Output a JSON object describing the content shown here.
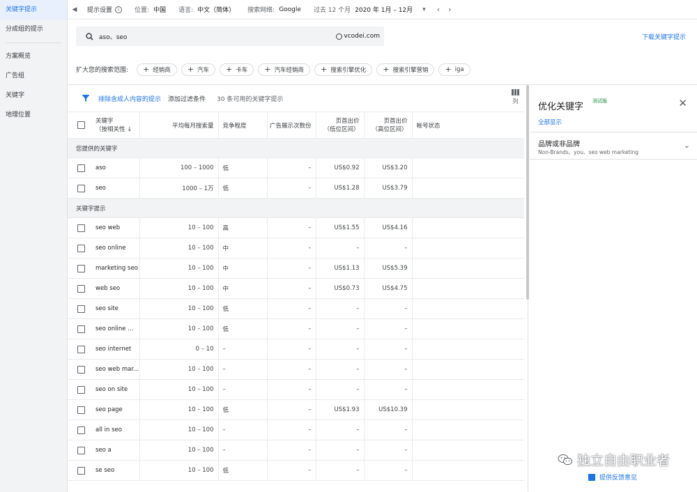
{
  "sidebar": {
    "items": [
      {
        "label": "关键字提示",
        "active": true
      },
      {
        "label": "分成组的提示"
      },
      {
        "label": "方案概览"
      },
      {
        "label": "广告组"
      },
      {
        "label": "关键字"
      },
      {
        "label": "地理位置"
      }
    ]
  },
  "topbar": {
    "title": "提示设置",
    "location_label": "位置:",
    "location_value": "中国",
    "language_label": "语言:",
    "language_value": "中文（简体）",
    "network_label": "搜索网络:",
    "network_value": "Google",
    "period_label": "过去 12 个月",
    "period_value": "2020 年 1月 – 12月"
  },
  "search": {
    "keywords": "aso、seo",
    "site": "vcodei.com",
    "download_label": "下载关键字提示"
  },
  "expand": {
    "label": "扩大您的搜索范围:",
    "chips": [
      "经销商",
      "汽车",
      "卡车",
      "汽车经销商",
      "搜索引擎优化",
      "搜索引擎营销",
      "iga"
    ]
  },
  "filter": {
    "exclude_label": "排除含成人内容的提示",
    "add_filter_label": "添加过滤条件",
    "count_label": "30 条可用的关键字提示",
    "columns_label": "列"
  },
  "table": {
    "headers": {
      "keyword_line1": "关键字",
      "keyword_line2": "（按相关性",
      "volume": "平均每月搜索量",
      "competition": "竞争程度",
      "impression_share": "广告展示次数份",
      "bid_low_line1": "页首出价",
      "bid_low_line2": "（低位区间）",
      "bid_high_line1": "页首出价",
      "bid_high_line2": "（高位区间）",
      "account_status": "帐号状态"
    },
    "section_provided": "您提供的关键字",
    "provided_rows": [
      {
        "keyword": "aso",
        "volume": "100 – 1000",
        "competition": "低",
        "share": "–",
        "low": "US$0.92",
        "high": "US$3.20"
      },
      {
        "keyword": "seo",
        "volume": "1000 – 1万",
        "competition": "低",
        "share": "–",
        "low": "US$1.28",
        "high": "US$3.79"
      }
    ],
    "section_ideas": "关键字提示",
    "idea_rows": [
      {
        "keyword": "seo web",
        "volume": "10 – 100",
        "competition": "高",
        "share": "–",
        "low": "US$1.55",
        "high": "US$4.16"
      },
      {
        "keyword": "seo online",
        "volume": "10 – 100",
        "competition": "中",
        "share": "–",
        "low": "–",
        "high": "–"
      },
      {
        "keyword": "marketing seo",
        "volume": "10 – 100",
        "competition": "中",
        "share": "–",
        "low": "US$1.13",
        "high": "US$5.39"
      },
      {
        "keyword": "web seo",
        "volume": "10 – 100",
        "competition": "中",
        "share": "–",
        "low": "US$0.73",
        "high": "US$4.75"
      },
      {
        "keyword": "seo site",
        "volume": "10 – 100",
        "competition": "低",
        "share": "–",
        "low": "–",
        "high": "–"
      },
      {
        "keyword": "seo online m...",
        "volume": "10 – 100",
        "competition": "低",
        "share": "–",
        "low": "–",
        "high": "–"
      },
      {
        "keyword": "seo internet",
        "volume": "0 – 10",
        "competition": "–",
        "share": "–",
        "low": "–",
        "high": "–"
      },
      {
        "keyword": "seo web mar...",
        "volume": "10 – 100",
        "competition": "–",
        "share": "–",
        "low": "–",
        "high": "–"
      },
      {
        "keyword": "seo on site",
        "volume": "10 – 100",
        "competition": "–",
        "share": "–",
        "low": "–",
        "high": "–"
      },
      {
        "keyword": "seo page",
        "volume": "10 – 100",
        "competition": "低",
        "share": "–",
        "low": "US$1.93",
        "high": "US$10.39"
      },
      {
        "keyword": "all in seo",
        "volume": "10 – 100",
        "competition": "–",
        "share": "–",
        "low": "–",
        "high": "–"
      },
      {
        "keyword": "seo a",
        "volume": "10 – 100",
        "competition": "–",
        "share": "–",
        "low": "–",
        "high": "–"
      },
      {
        "keyword": "se seo",
        "volume": "10 – 100",
        "competition": "低",
        "share": "–",
        "low": "–",
        "high": "–"
      }
    ]
  },
  "right_panel": {
    "title": "优化关键字",
    "beta": "测试版",
    "show_all": "全部显示",
    "brand_title": "品牌或非品牌",
    "brand_sub": "Non-Brands、you、seo web marketing",
    "feedback": "提供反馈意见",
    "watermark": "独立自由职业者"
  },
  "colors": {
    "accent": "#1a73e8",
    "sidebar_bg": "#f1f3f4",
    "beta": "#1e8e3e"
  }
}
